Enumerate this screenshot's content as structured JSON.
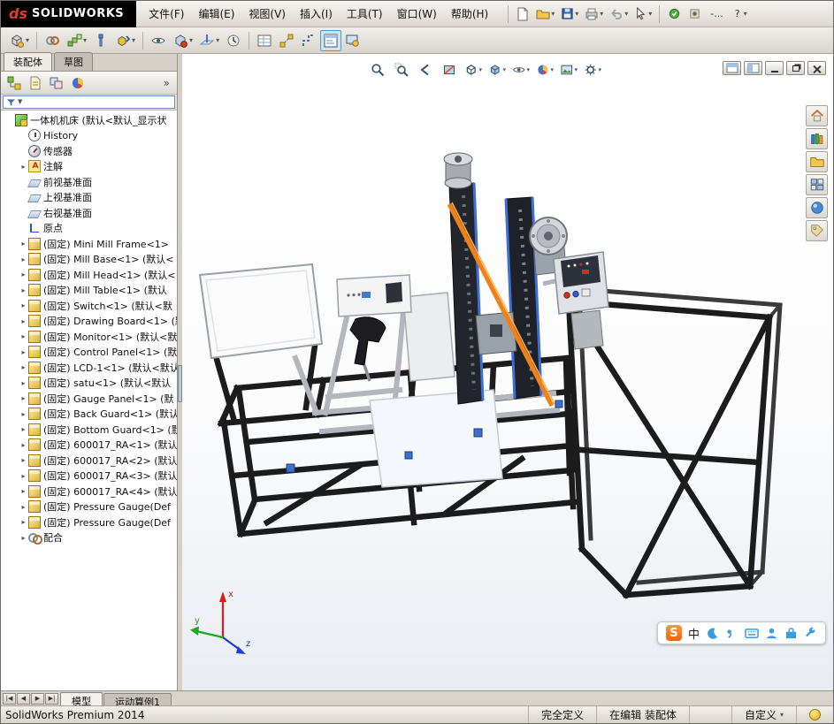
{
  "app": {
    "logo_prefix": "ds",
    "logo_text": "SOLIDWORKS",
    "menus": [
      "文件(F)",
      "编辑(E)",
      "视图(V)",
      "插入(I)",
      "工具(T)",
      "窗口(W)",
      "帮助(H)"
    ],
    "overflow_label": "-...",
    "help_glyph": "?"
  },
  "panel": {
    "tabs": [
      {
        "label": "装配体",
        "cls": "active"
      },
      {
        "label": "草图",
        "cls": ""
      }
    ],
    "chevron": "»"
  },
  "tree": {
    "items": [
      {
        "arrow": "",
        "icon": "ico-asm",
        "cls": "root",
        "label": "一体机机床 (默认<默认_显示状"
      },
      {
        "arrow": "",
        "icon": "ico-hist",
        "cls": "",
        "label": "History"
      },
      {
        "arrow": "",
        "icon": "ico-sensor",
        "cls": "",
        "label": "传感器"
      },
      {
        "arrow": "▸",
        "icon": "ico-ann",
        "cls": "",
        "label": "注解"
      },
      {
        "arrow": "",
        "icon": "ico-plane",
        "cls": "",
        "label": "前视基准面"
      },
      {
        "arrow": "",
        "icon": "ico-plane",
        "cls": "",
        "label": "上视基准面"
      },
      {
        "arrow": "",
        "icon": "ico-plane",
        "cls": "",
        "label": "右视基准面"
      },
      {
        "arrow": "",
        "icon": "ico-origin",
        "cls": "",
        "label": "原点"
      },
      {
        "arrow": "▸",
        "icon": "ico-part",
        "cls": "",
        "label": "(固定) Mini Mill Frame<1>"
      },
      {
        "arrow": "▸",
        "icon": "ico-part",
        "cls": "",
        "label": "(固定) Mill Base<1> (默认<"
      },
      {
        "arrow": "▸",
        "icon": "ico-part",
        "cls": "",
        "label": "(固定) Mill Head<1> (默认<"
      },
      {
        "arrow": "▸",
        "icon": "ico-part",
        "cls": "",
        "label": "(固定) Mill Table<1> (默认"
      },
      {
        "arrow": "▸",
        "icon": "ico-part",
        "cls": "",
        "label": "(固定) Switch<1> (默认<默"
      },
      {
        "arrow": "▸",
        "icon": "ico-part",
        "cls": "",
        "label": "(固定) Drawing Board<1> (默"
      },
      {
        "arrow": "▸",
        "icon": "ico-part",
        "cls": "",
        "label": "(固定) Monitor<1> (默认<默"
      },
      {
        "arrow": "▸",
        "icon": "ico-part",
        "cls": "",
        "label": "(固定) Control Panel<1> (默"
      },
      {
        "arrow": "▸",
        "icon": "ico-part",
        "cls": "",
        "label": "(固定) LCD-1<1> (默认<默认"
      },
      {
        "arrow": "▸",
        "icon": "ico-part",
        "cls": "",
        "label": "(固定) satu<1> (默认<默认"
      },
      {
        "arrow": "▸",
        "icon": "ico-part",
        "cls": "",
        "label": "(固定) Gauge Panel<1> (默"
      },
      {
        "arrow": "▸",
        "icon": "ico-part",
        "cls": "",
        "label": "(固定) Back Guard<1> (默认"
      },
      {
        "arrow": "▸",
        "icon": "ico-part",
        "cls": "",
        "label": "(固定) Bottom Guard<1> (默"
      },
      {
        "arrow": "▸",
        "icon": "ico-part",
        "cls": "",
        "label": "(固定) 600017_RA<1> (默认"
      },
      {
        "arrow": "▸",
        "icon": "ico-part",
        "cls": "",
        "label": "(固定) 600017_RA<2> (默认"
      },
      {
        "arrow": "▸",
        "icon": "ico-part",
        "cls": "",
        "label": "(固定) 600017_RA<3> (默认"
      },
      {
        "arrow": "▸",
        "icon": "ico-part",
        "cls": "",
        "label": "(固定) 600017_RA<4> (默认"
      },
      {
        "arrow": "▸",
        "icon": "ico-part",
        "cls": "",
        "label": "(固定) Pressure Gauge(Def"
      },
      {
        "arrow": "▸",
        "icon": "ico-part",
        "cls": "",
        "label": "(固定) Pressure Gauge(Def"
      },
      {
        "arrow": "▸",
        "icon": "ico-mate",
        "cls": "",
        "label": "配合"
      }
    ]
  },
  "viewport": {
    "triad": {
      "x": "x",
      "y": "y",
      "z": "z"
    }
  },
  "ime": {
    "logo": "S",
    "mode": "中"
  },
  "tabs": {
    "nav": [
      "|◀",
      "◀",
      "▶",
      "▶|"
    ],
    "items": [
      {
        "label": "模型",
        "cls": "active"
      },
      {
        "label": "运动算例1",
        "cls": ""
      }
    ]
  },
  "statusbar": {
    "product": "SolidWorks Premium 2014",
    "defined": "完全定义",
    "editing": "在编辑 装配体",
    "custom": "自定义"
  }
}
